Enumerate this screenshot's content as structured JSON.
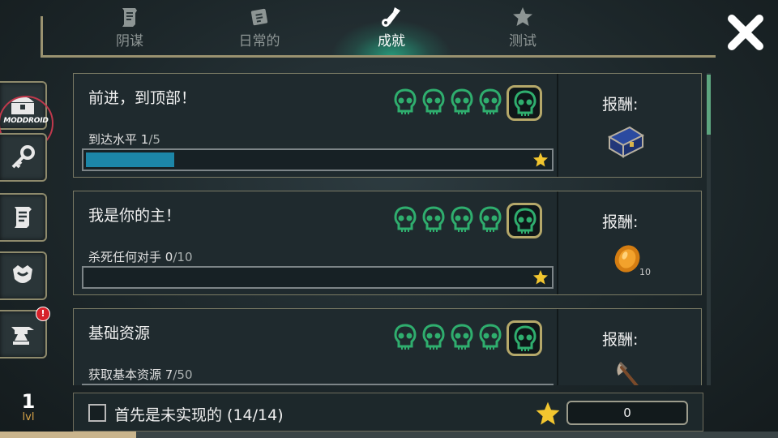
{
  "tabs": [
    {
      "label": "阴谋",
      "icon": "scroll-icon",
      "active": false
    },
    {
      "label": "日常的",
      "icon": "calendar-icon",
      "active": false
    },
    {
      "label": "成就",
      "icon": "trophy-icon",
      "active": true
    },
    {
      "label": "测试",
      "icon": "star-icon",
      "active": false
    }
  ],
  "close_icon": "close-icon",
  "sidebar": {
    "watermark": "MODDROID",
    "items": [
      "chest-icon",
      "key-icon",
      "scroll-icon",
      "armor-icon",
      "anvil-icon"
    ],
    "alert_badge": "!"
  },
  "player": {
    "level": "1",
    "level_label": "lvl",
    "xp_progress": 0.175
  },
  "achievements": [
    {
      "title": "前进，到顶部！",
      "task": "到达水平",
      "current": "1",
      "total": "/5",
      "progress": 0.2,
      "reward_label": "报酬:",
      "reward_icon": "treasure-chest-icon",
      "reward_count": ""
    },
    {
      "title": "我是你的主！",
      "task": "杀死任何对手",
      "current": "0",
      "total": "/10",
      "progress": 0.0,
      "reward_label": "报酬:",
      "reward_icon": "coin-icon",
      "reward_count": "10"
    },
    {
      "title": "基础资源",
      "task": "获取基本资源",
      "current": "7",
      "total": "/50",
      "progress": 0.14,
      "reward_label": "报酬:",
      "reward_icon": "axe-icon",
      "reward_count": ""
    }
  ],
  "filter": {
    "label": "首先是未实现的 (14/14)",
    "checked": false
  },
  "score": "0",
  "colors": {
    "accent": "#28d2a0",
    "progress": "#1c86a8",
    "frame": "#9a9270",
    "skull": "#2fae6e",
    "star": "#f2c62f"
  }
}
